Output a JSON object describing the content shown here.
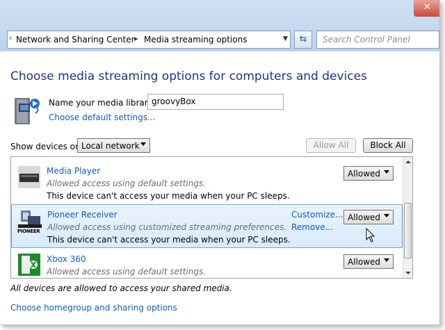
{
  "breadcrumb": {
    "item1": "Network and Sharing Center",
    "item2": "Media streaming options"
  },
  "search": {
    "placeholder": "Search Control Panel"
  },
  "page_title": "Choose media streaming options for computers and devices",
  "library": {
    "label": "Name your media library:",
    "value": "groovyBox",
    "default_settings_link": "Choose default settings..."
  },
  "devices_filter": {
    "label": "Show devices on:",
    "selected": "Local network"
  },
  "buttons": {
    "allow_all": "Allow All",
    "block_all": "Block All"
  },
  "devices": [
    {
      "name": "Media Player",
      "desc": "Allowed access using default settings.",
      "warning": "This device can't access your media when your PC sleeps.",
      "status": "Allowed",
      "icon": "media-player-icon"
    },
    {
      "name": "Pioneer Receiver",
      "desc": "Allowed access using customized streaming preferences.",
      "warning": "This device can't access your media when your PC sleeps.",
      "status": "Allowed",
      "customize": "Customize...",
      "remove": "Remove...",
      "icon": "pioneer-receiver-icon",
      "icon_text": "PIONEER"
    },
    {
      "name": "Xbox 360",
      "desc": "Allowed access using default settings.",
      "status": "Allowed",
      "icon": "xbox-360-icon"
    }
  ],
  "footer": {
    "note": "All devices are allowed to access your shared media.",
    "homegroup_link": "Choose homegroup and sharing options"
  },
  "colors": {
    "title_blue": "#1e3287",
    "link_blue": "#0d5bc4",
    "selected_row": "#d8eafc"
  }
}
